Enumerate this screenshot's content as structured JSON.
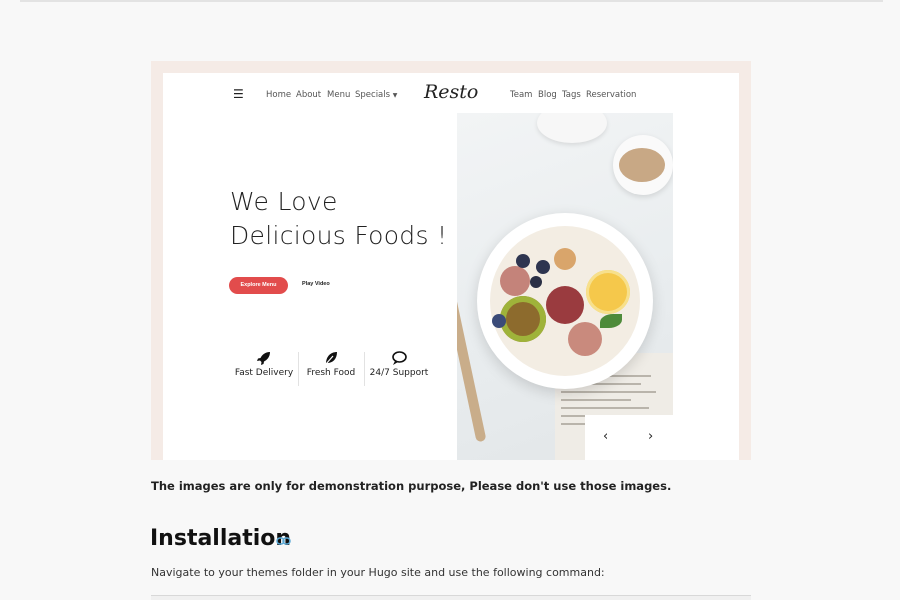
{
  "preview": {
    "nav": {
      "left_links": [
        "Home",
        "About",
        "Menu",
        "Specials"
      ],
      "logo": "Resto",
      "right_links": [
        "Team",
        "Blog",
        "Tags",
        "Reservation"
      ]
    },
    "hero": {
      "title_line1": "We Love",
      "title_line2": "Delicious Foods !",
      "explore_label": "Explore Menu",
      "play_label": "Play Video"
    },
    "features": [
      {
        "icon": "rocket-icon",
        "label": "Fast Delivery"
      },
      {
        "icon": "leaf-icon",
        "label": "Fresh Food"
      },
      {
        "icon": "chat-icon",
        "label": "24/7 Support"
      }
    ],
    "slider": {
      "prev": "‹",
      "next": "›"
    }
  },
  "doc": {
    "note": "The images are only for demonstration purpose, Please don't use those images.",
    "heading": "Installation",
    "paragraph": "Navigate to your themes folder in your Hugo site and use the following command:"
  },
  "colors": {
    "accent": "#e24c4c",
    "frame": "#f5ebe6",
    "link": "#5aa9d6"
  }
}
